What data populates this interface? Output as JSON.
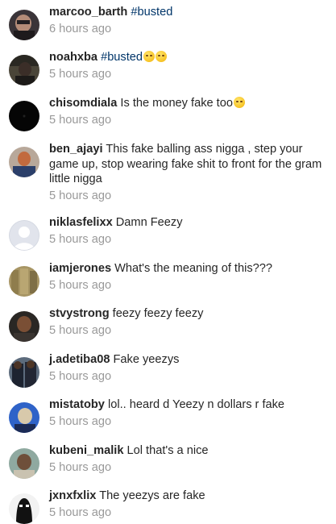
{
  "comments": [
    {
      "username": "marcoo_barth",
      "text": "",
      "hashtag": "#busted",
      "emoji": "",
      "time": "6 hours ago",
      "avatar_icon": "avatar-photo"
    },
    {
      "username": "noahxba",
      "text": "",
      "hashtag": "#busted",
      "emoji": "woozy-face-emoji x2",
      "time": "5 hours ago",
      "avatar_icon": "avatar-photo"
    },
    {
      "username": "chisomdiala",
      "text": "Is the money fake too",
      "hashtag": "",
      "emoji": "grinning-sweat-emoji",
      "time": "5 hours ago",
      "avatar_icon": "avatar-photo"
    },
    {
      "username": "ben_ajayi",
      "text": "This fake balling ass nigga , step your game up, stop wearing fake shit to front for the gram little nigga",
      "hashtag": "",
      "emoji": "",
      "time": "5 hours ago",
      "avatar_icon": "avatar-photo"
    },
    {
      "username": "niklasfelixx",
      "text": "Damn Feezy",
      "hashtag": "",
      "emoji": "",
      "time": "5 hours ago",
      "avatar_icon": "default-avatar-icon"
    },
    {
      "username": "iamjerones",
      "text": "What's the meaning of this???",
      "hashtag": "",
      "emoji": "",
      "time": "5 hours ago",
      "avatar_icon": "avatar-photo"
    },
    {
      "username": "stvystrong",
      "text": "feezy feezy feezy",
      "hashtag": "",
      "emoji": "",
      "time": "5 hours ago",
      "avatar_icon": "avatar-photo"
    },
    {
      "username": "j.adetiba08",
      "text": "Fake yeezys",
      "hashtag": "",
      "emoji": "",
      "time": "5 hours ago",
      "avatar_icon": "avatar-photo"
    },
    {
      "username": "mistatoby",
      "text": "lol.. heard d Yeezy n dollars r fake",
      "hashtag": "",
      "emoji": "",
      "time": "5 hours ago",
      "avatar_icon": "avatar-photo"
    },
    {
      "username": "kubeni_malik",
      "text": "Lol that's a nice",
      "hashtag": "",
      "emoji": "",
      "time": "5 hours ago",
      "avatar_icon": "avatar-photo"
    },
    {
      "username": "jxnxfxlix",
      "text": "The yeezys are fake",
      "hashtag": "",
      "emoji": "",
      "time": "5 hours ago",
      "avatar_icon": "avatar-photo"
    }
  ],
  "colors": {
    "username": "#262626",
    "hashtag": "#003569",
    "timestamp": "#999999"
  }
}
